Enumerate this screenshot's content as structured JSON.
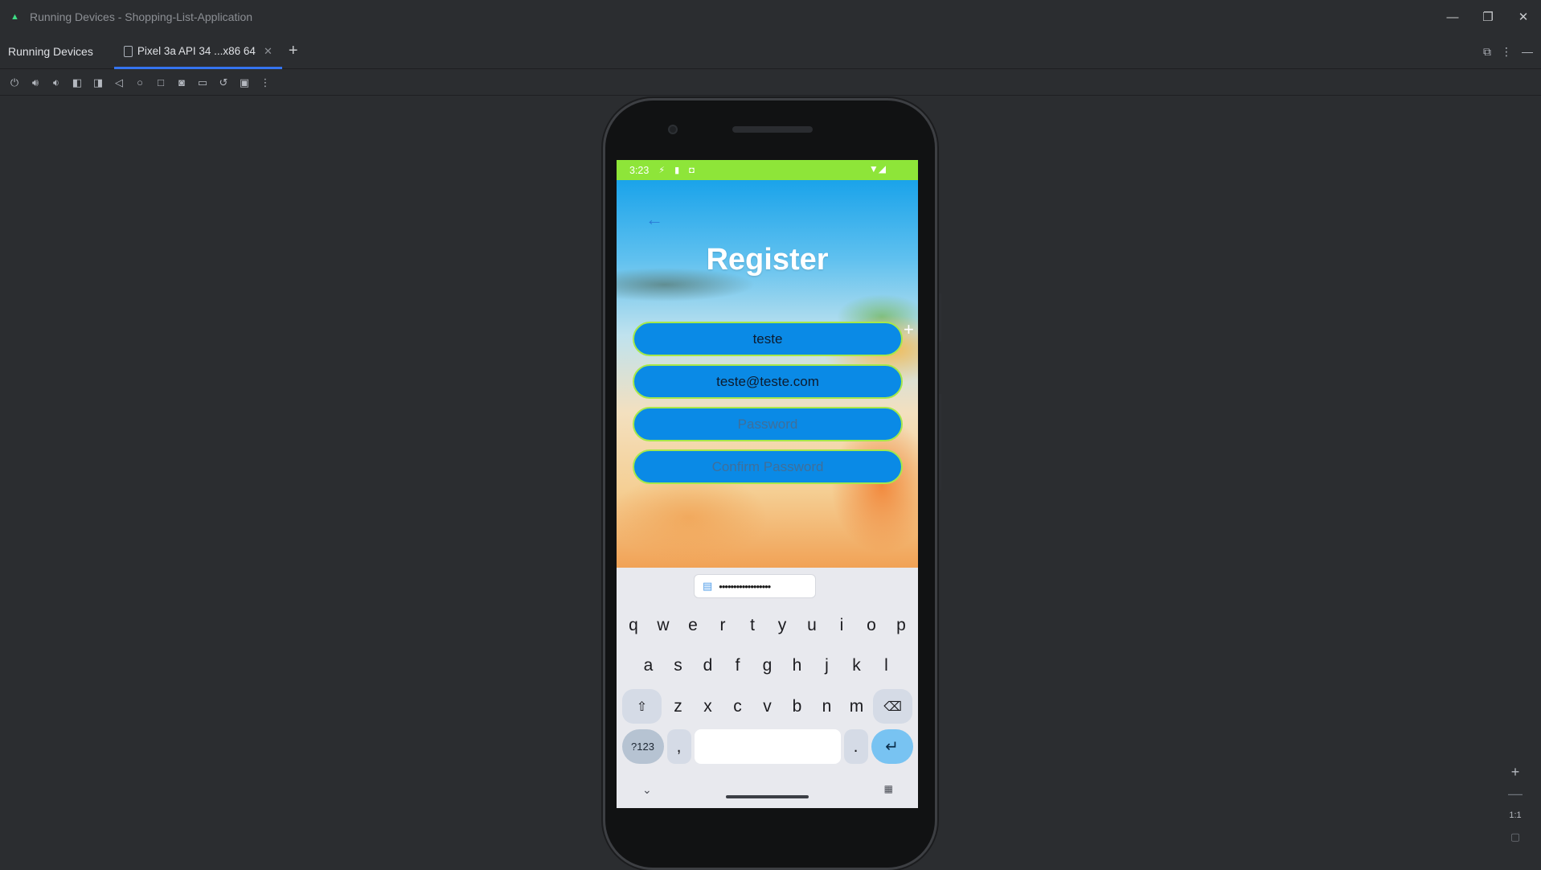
{
  "window": {
    "title": "Running Devices - Shopping-List-Application"
  },
  "tool_window": {
    "title": "Running Devices",
    "tab_label": "Pixel 3a API 34 ...x86 64"
  },
  "device": {
    "status_time": "3:23"
  },
  "register_screen": {
    "title": "Register",
    "fields": [
      {
        "name": "username",
        "value": "teste",
        "placeholder": ""
      },
      {
        "name": "email",
        "value": "teste@teste.com",
        "placeholder": ""
      },
      {
        "name": "password",
        "value": "",
        "placeholder": "Password"
      },
      {
        "name": "confirm_password",
        "value": "",
        "placeholder": "Confirm Password"
      }
    ]
  },
  "keyboard": {
    "clipboard_suggestion": "••••••••••••••••••",
    "row1": [
      "q",
      "w",
      "e",
      "r",
      "t",
      "y",
      "u",
      "i",
      "o",
      "p"
    ],
    "row2": [
      "a",
      "s",
      "d",
      "f",
      "g",
      "h",
      "j",
      "k",
      "l"
    ],
    "row3": [
      "z",
      "x",
      "c",
      "v",
      "b",
      "n",
      "m"
    ],
    "symbols_key": "?123",
    "comma_key": ",",
    "period_key": "."
  },
  "zoom_controls": {
    "one_to_one": "1:1"
  }
}
